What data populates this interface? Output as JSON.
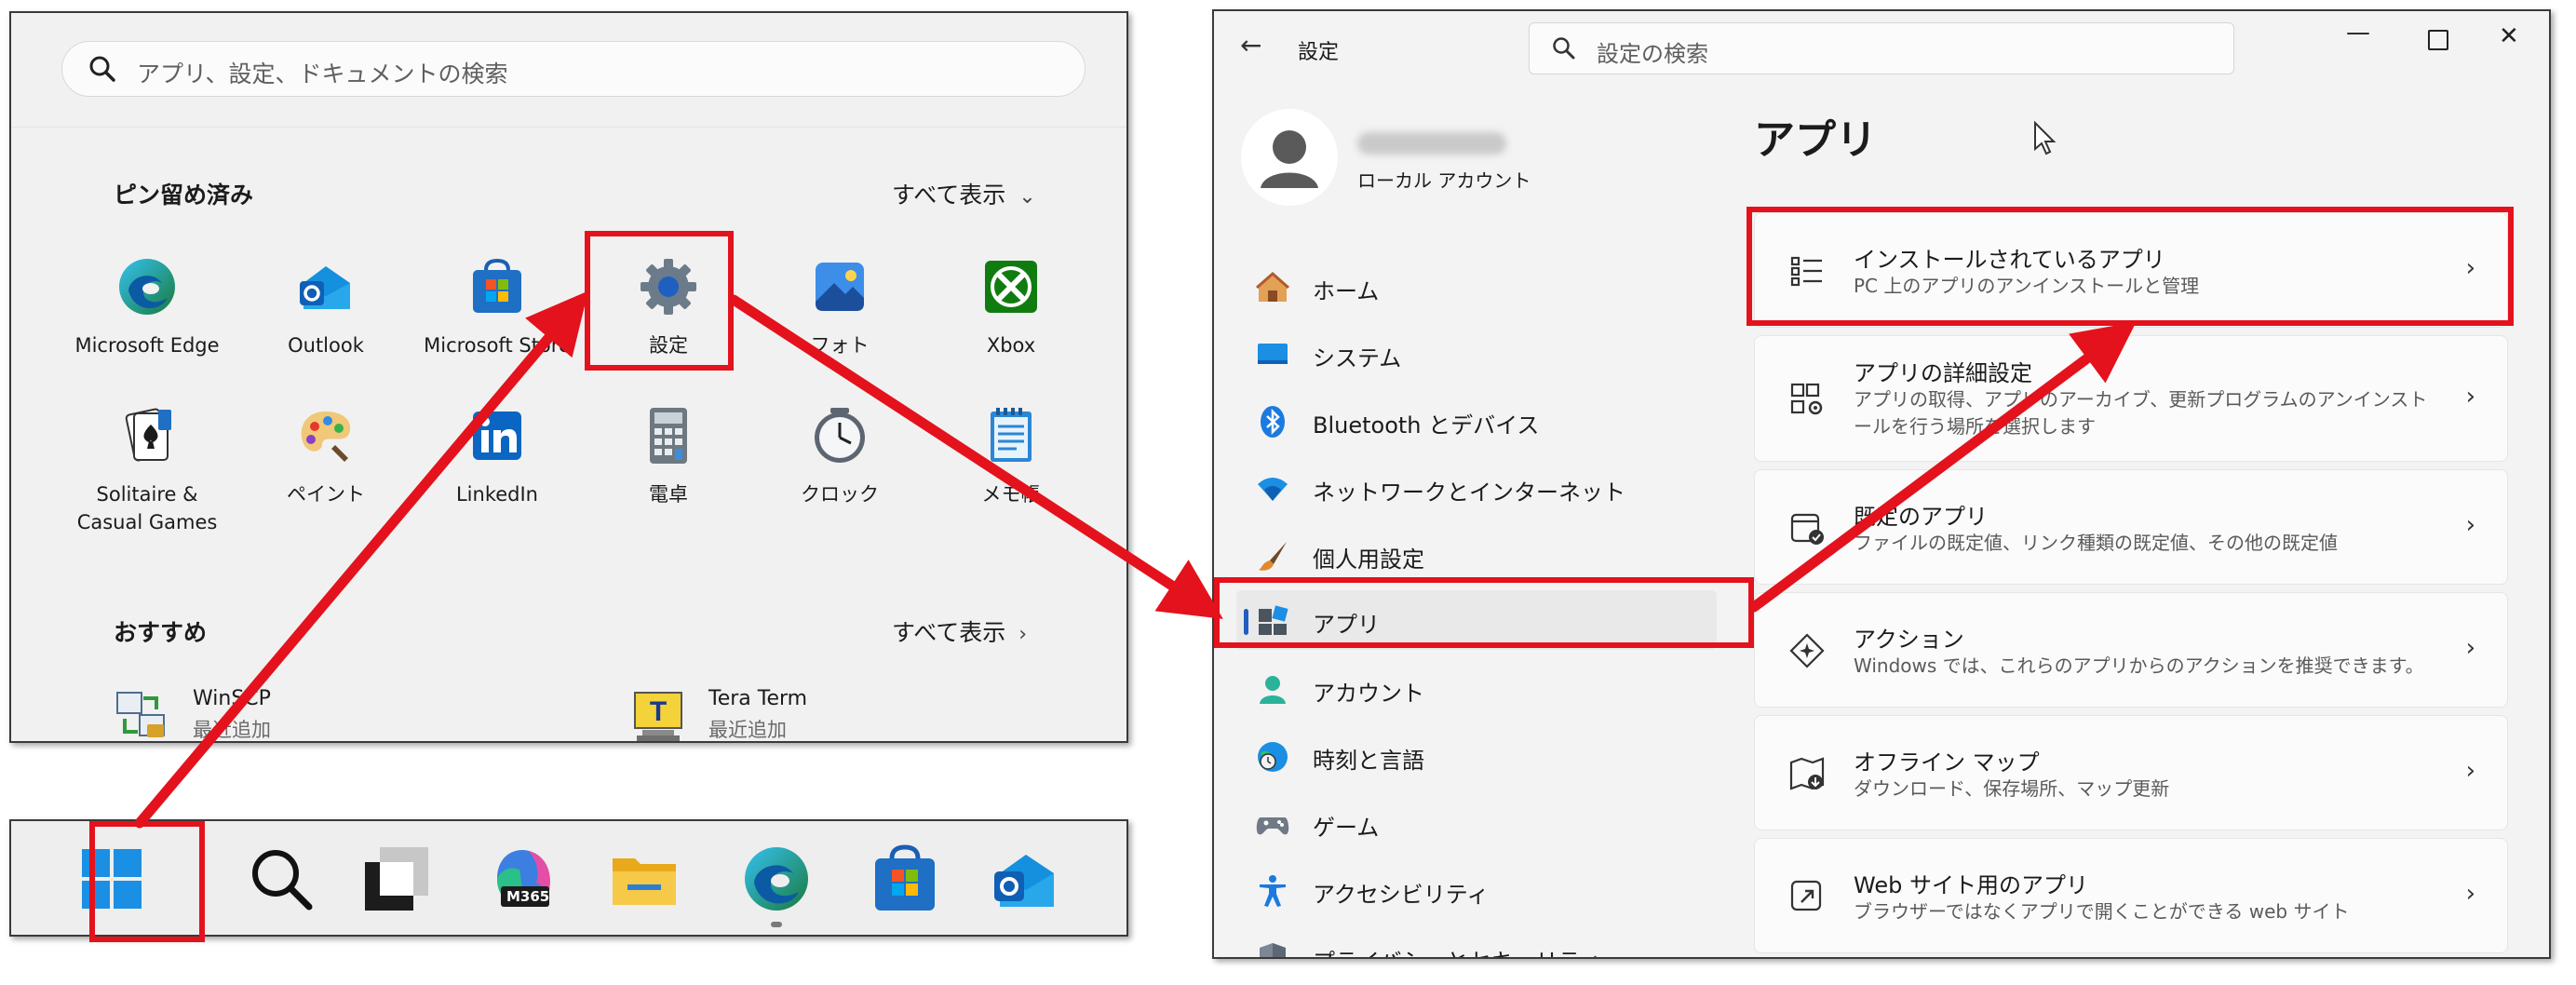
{
  "start_menu": {
    "search_placeholder": "アプリ、設定、ドキュメントの検索",
    "pinned": {
      "heading": "ピン留め済み",
      "show_all": "すべて表示",
      "apps": [
        {
          "label": "Microsoft Edge",
          "icon": "edge-icon"
        },
        {
          "label": "Outlook",
          "icon": "outlook-icon"
        },
        {
          "label": "Microsoft Store",
          "icon": "store-icon"
        },
        {
          "label": "設定",
          "icon": "gear-icon"
        },
        {
          "label": "フォト",
          "icon": "photos-icon"
        },
        {
          "label": "Xbox",
          "icon": "xbox-icon"
        },
        {
          "label": "Solitaire &\nCasual Games",
          "icon": "solitaire-icon"
        },
        {
          "label": "ペイント",
          "icon": "paint-icon"
        },
        {
          "label": "LinkedIn",
          "icon": "linkedin-icon"
        },
        {
          "label": "電卓",
          "icon": "calculator-icon"
        },
        {
          "label": "クロック",
          "icon": "clock-icon"
        },
        {
          "label": "メモ帳",
          "icon": "notepad-icon"
        }
      ]
    },
    "recommended": {
      "heading": "おすすめ",
      "show_all": "すべて表示",
      "items": [
        {
          "title": "WinSCP",
          "subtitle": "最近追加",
          "icon": "winscp-icon"
        },
        {
          "title": "Tera Term",
          "subtitle": "最近追加",
          "icon": "teraterm-icon"
        }
      ]
    }
  },
  "taskbar": {
    "icons": [
      "windows-start-icon",
      "search-icon",
      "task-view-icon",
      "m365-icon",
      "file-explorer-icon",
      "edge-icon",
      "store-icon",
      "outlook-icon"
    ],
    "m365_label": "M365"
  },
  "settings": {
    "title": "設定",
    "search_placeholder": "設定の検索",
    "account": {
      "type": "ローカル アカウント"
    },
    "page_title": "アプリ",
    "nav": [
      {
        "label": "ホーム",
        "icon": "home-icon"
      },
      {
        "label": "システム",
        "icon": "system-icon"
      },
      {
        "label": "Bluetooth とデバイス",
        "icon": "bluetooth-icon"
      },
      {
        "label": "ネットワークとインターネット",
        "icon": "network-icon"
      },
      {
        "label": "個人用設定",
        "icon": "brush-icon"
      },
      {
        "label": "アプリ",
        "icon": "apps-icon"
      },
      {
        "label": "アカウント",
        "icon": "account-icon"
      },
      {
        "label": "時刻と言語",
        "icon": "time-language-icon"
      },
      {
        "label": "ゲーム",
        "icon": "gaming-icon"
      },
      {
        "label": "アクセシビリティ",
        "icon": "accessibility-icon"
      },
      {
        "label": "プライバシーとセキュリティ",
        "icon": "privacy-icon"
      }
    ],
    "cards": [
      {
        "title": "インストールされているアプリ",
        "desc": "PC 上のアプリのアンインストールと管理",
        "icon": "installed-apps-icon"
      },
      {
        "title": "アプリの詳細設定",
        "desc": "アプリの取得、アプリのアーカイブ、更新プログラムのアンインストールを行う場所を選択します",
        "icon": "advanced-apps-icon"
      },
      {
        "title": "既定のアプリ",
        "desc": "ファイルの既定値、リンク種類の既定値、その他の既定値",
        "icon": "default-apps-icon"
      },
      {
        "title": "アクション",
        "desc": "Windows では、これらのアプリからのアクションを推奨できます。",
        "icon": "actions-icon"
      },
      {
        "title": "オフライン マップ",
        "desc": "ダウンロード、保存場所、マップ更新",
        "icon": "offline-maps-icon"
      },
      {
        "title": "Web サイト用のアプリ",
        "desc": "ブラウザーではなくアプリで開くことができる web サイト",
        "icon": "web-apps-icon"
      }
    ]
  },
  "colors": {
    "highlight": "#e4121c",
    "accent": "#1f5fbf"
  }
}
